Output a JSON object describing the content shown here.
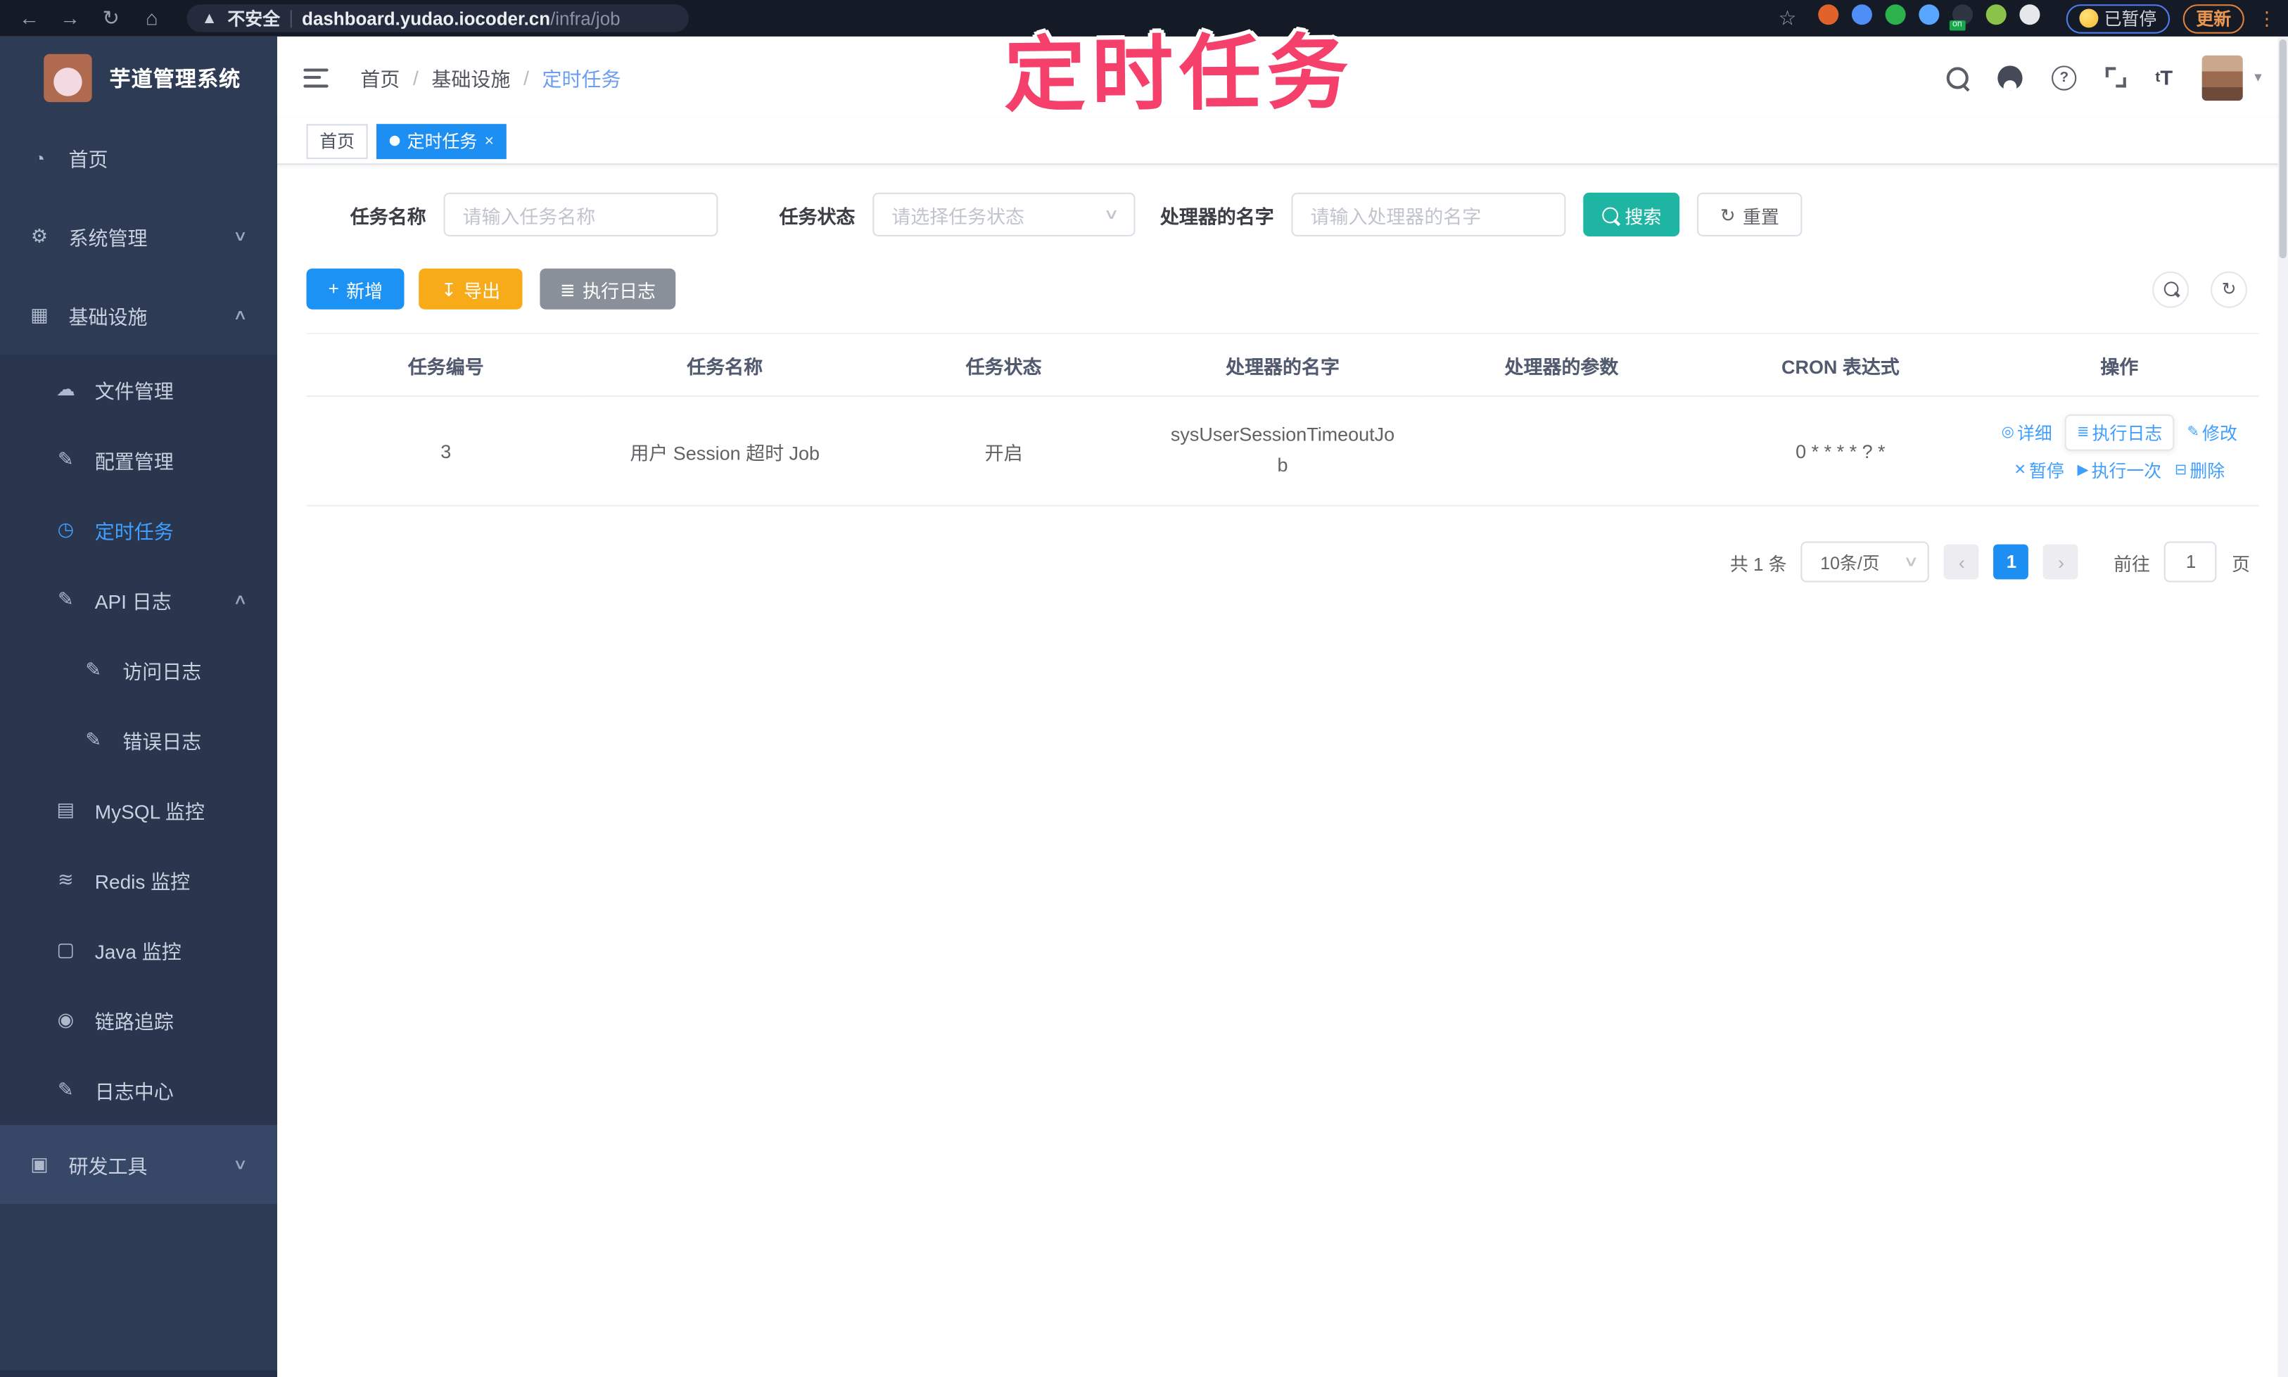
{
  "colors": {
    "primary": "#409eff",
    "active-tag": "#1e8ff2",
    "search-teal": "#1fb5a3",
    "export-amber": "#f7ab18",
    "info-gray": "#8a9099",
    "annotation-pink": "#f5406b",
    "sidebar-bg": "#2d3b54",
    "submenu-bg": "#29364d"
  },
  "browser": {
    "security_label": "不安全",
    "url_host": "dashboard.yudao.iocoder.cn",
    "url_path": "/infra/job",
    "paused_label": "已暂停",
    "update_label": "更新",
    "extensions": [
      {
        "name": "extension-orange-icon",
        "color": "#e2622b"
      },
      {
        "name": "extension-blue-gem-icon",
        "color": "#4f8ef7"
      },
      {
        "name": "extension-green-check-icon",
        "color": "#2bb24c"
      },
      {
        "name": "extension-lightblue-icon",
        "color": "#58a6ff"
      },
      {
        "name": "extension-dark-icon",
        "color": "#2f3542",
        "badge": "on"
      },
      {
        "name": "extension-lime-icon",
        "color": "#8bc34a"
      },
      {
        "name": "extension-puzzle-icon",
        "color": "#e5e7eb"
      }
    ]
  },
  "annotation": {
    "text": "定时任务"
  },
  "sidebar": {
    "logo_title": "芋道管理系统",
    "items": [
      {
        "label": "首页",
        "icon": "dashboard-icon",
        "glyph": "◔",
        "level": 0
      },
      {
        "label": "系统管理",
        "icon": "gear-icon",
        "glyph": "⚙",
        "level": 0,
        "chevron": "down"
      },
      {
        "label": "基础设施",
        "icon": "infra-icon",
        "glyph": "▦",
        "level": 0,
        "chevron": "up"
      },
      {
        "label": "文件管理",
        "icon": "cloud-upload-icon",
        "glyph": "☁",
        "level": 1
      },
      {
        "label": "配置管理",
        "icon": "edit-square-icon",
        "glyph": "✎",
        "level": 1
      },
      {
        "label": "定时任务",
        "icon": "timer-icon",
        "glyph": "◷",
        "level": 1,
        "active": true
      },
      {
        "label": "API 日志",
        "icon": "api-log-icon",
        "glyph": "✎",
        "level": 1,
        "chevron": "up"
      },
      {
        "label": "访问日志",
        "icon": "access-log-icon",
        "glyph": "✎",
        "level": 2
      },
      {
        "label": "错误日志",
        "icon": "error-log-icon",
        "glyph": "✎",
        "level": 2
      },
      {
        "label": "MySQL 监控",
        "icon": "mysql-monitor-icon",
        "glyph": "▤",
        "level": 1
      },
      {
        "label": "Redis 监控",
        "icon": "redis-monitor-icon",
        "glyph": "≋",
        "level": 1
      },
      {
        "label": "Java 监控",
        "icon": "java-monitor-icon",
        "glyph": "▢",
        "level": 1
      },
      {
        "label": "链路追踪",
        "icon": "trace-icon",
        "glyph": "◉",
        "level": 1
      },
      {
        "label": "日志中心",
        "icon": "log-center-icon",
        "glyph": "✎",
        "level": 1
      },
      {
        "label": "研发工具",
        "icon": "devtools-icon",
        "glyph": "▣",
        "level": 0,
        "chevron": "down",
        "band": true
      }
    ]
  },
  "header": {
    "breadcrumb": [
      "首页",
      "基础设施",
      "定时任务"
    ]
  },
  "tags": [
    {
      "label": "首页",
      "active": false,
      "closable": false
    },
    {
      "label": "定时任务",
      "active": true,
      "closable": true
    }
  ],
  "search": {
    "name_label": "任务名称",
    "name_placeholder": "请输入任务名称",
    "status_label": "任务状态",
    "status_placeholder": "请选择任务状态",
    "handler_label": "处理器的名字",
    "handler_placeholder": "请输入处理器的名字",
    "search_label": "搜索",
    "reset_label": "重置"
  },
  "toolbar": {
    "add_label": "新增",
    "export_label": "导出",
    "execlog_label": "执行日志"
  },
  "table": {
    "columns": [
      "任务编号",
      "任务名称",
      "任务状态",
      "处理器的名字",
      "处理器的参数",
      "CRON 表达式",
      "操作"
    ],
    "rows": [
      {
        "id": "3",
        "name": "用户 Session 超时 Job",
        "status": "开启",
        "handler": "sysUserSessionTimeoutJob",
        "params": "",
        "cron": "0 * * * * ? *"
      }
    ],
    "ops": [
      {
        "label": "详细",
        "icon": "eye-icon",
        "glyph": "◎"
      },
      {
        "label": "执行日志",
        "icon": "list-icon",
        "glyph": "≣",
        "boxed": true
      },
      {
        "label": "修改",
        "icon": "edit-icon",
        "glyph": "✎"
      },
      {
        "label": "暂停",
        "icon": "pause-icon",
        "glyph": "✕"
      },
      {
        "label": "执行一次",
        "icon": "play-icon",
        "glyph": "▶"
      },
      {
        "label": "删除",
        "icon": "delete-icon",
        "glyph": "⊟"
      }
    ]
  },
  "pagination": {
    "total": "共 1 条",
    "page_size": "10条/页",
    "prev": "‹",
    "next": "›",
    "current": "1",
    "goto_label": "前往",
    "goto_value": "1",
    "page_label": "页"
  }
}
